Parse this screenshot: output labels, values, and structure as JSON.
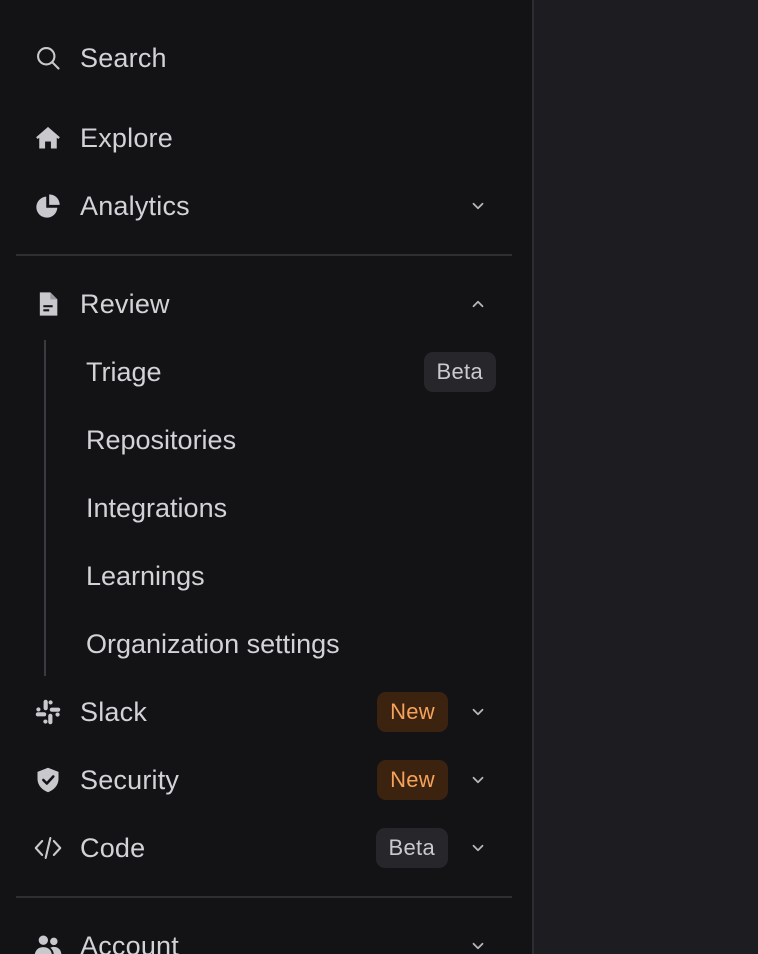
{
  "sidebar": {
    "search": {
      "label": "Search",
      "icon": "search-icon"
    },
    "explore": {
      "label": "Explore",
      "icon": "home-icon"
    },
    "analytics": {
      "label": "Analytics",
      "icon": "pie-chart-icon",
      "expanded": false
    },
    "review": {
      "label": "Review",
      "icon": "document-icon",
      "expanded": true,
      "children": [
        {
          "label": "Triage",
          "badge": "Beta"
        },
        {
          "label": "Repositories"
        },
        {
          "label": "Integrations"
        },
        {
          "label": "Learnings"
        },
        {
          "label": "Organization settings"
        }
      ]
    },
    "slack": {
      "label": "Slack",
      "icon": "slack-icon",
      "badge": "New",
      "expanded": false
    },
    "security": {
      "label": "Security",
      "icon": "shield-check-icon",
      "badge": "New",
      "expanded": false
    },
    "code": {
      "label": "Code",
      "icon": "code-icon",
      "badge": "Beta",
      "expanded": false
    },
    "account": {
      "label": "Account",
      "icon": "users-icon",
      "expanded": false
    }
  },
  "colors": {
    "sidebar_bg": "#131316",
    "main_bg": "#1d1c21",
    "text": "#d2d2d7",
    "badge_new_bg": "#3b2310",
    "badge_new_text": "#f5a25a",
    "badge_beta_bg": "#26262b"
  }
}
